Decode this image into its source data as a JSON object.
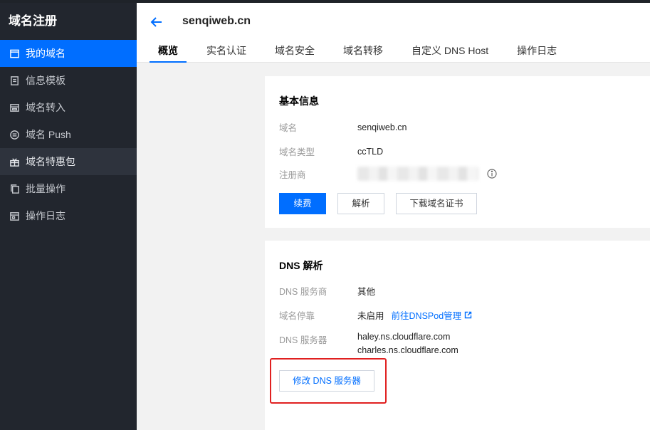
{
  "sidebar": {
    "title": "域名注册",
    "items": [
      {
        "label": "我的域名",
        "icon": "calendar-icon"
      },
      {
        "label": "信息模板",
        "icon": "document-icon"
      },
      {
        "label": "域名转入",
        "icon": "transfer-in-icon"
      },
      {
        "label": "域名 Push",
        "icon": "push-icon"
      },
      {
        "label": "域名特惠包",
        "icon": "gift-icon"
      },
      {
        "label": "批量操作",
        "icon": "copy-icon"
      },
      {
        "label": "操作日志",
        "icon": "log-icon"
      }
    ]
  },
  "header": {
    "domain": "senqiweb.cn",
    "tabs": [
      "概览",
      "实名认证",
      "域名安全",
      "域名转移",
      "自定义 DNS Host",
      "操作日志"
    ]
  },
  "basic": {
    "title": "基本信息",
    "domain_label": "域名",
    "domain_value": "senqiweb.cn",
    "type_label": "域名类型",
    "type_value": "ccTLD",
    "registrar_label": "注册商",
    "renew": "续费",
    "resolve": "解析",
    "download_cert": "下载域名证书"
  },
  "dns": {
    "title": "DNS 解析",
    "provider_label": "DNS 服务商",
    "provider_value": "其他",
    "parking_label": "域名停靠",
    "parking_value": "未启用",
    "parking_link": "前往DNSPod管理",
    "servers_label": "DNS 服务器",
    "server1": "haley.ns.cloudflare.com",
    "server2": "charles.ns.cloudflare.com",
    "modify": "修改 DNS 服务器"
  },
  "colors": {
    "accent": "#006eff",
    "sidebar": "#22262e",
    "highlight": "#e02020"
  }
}
